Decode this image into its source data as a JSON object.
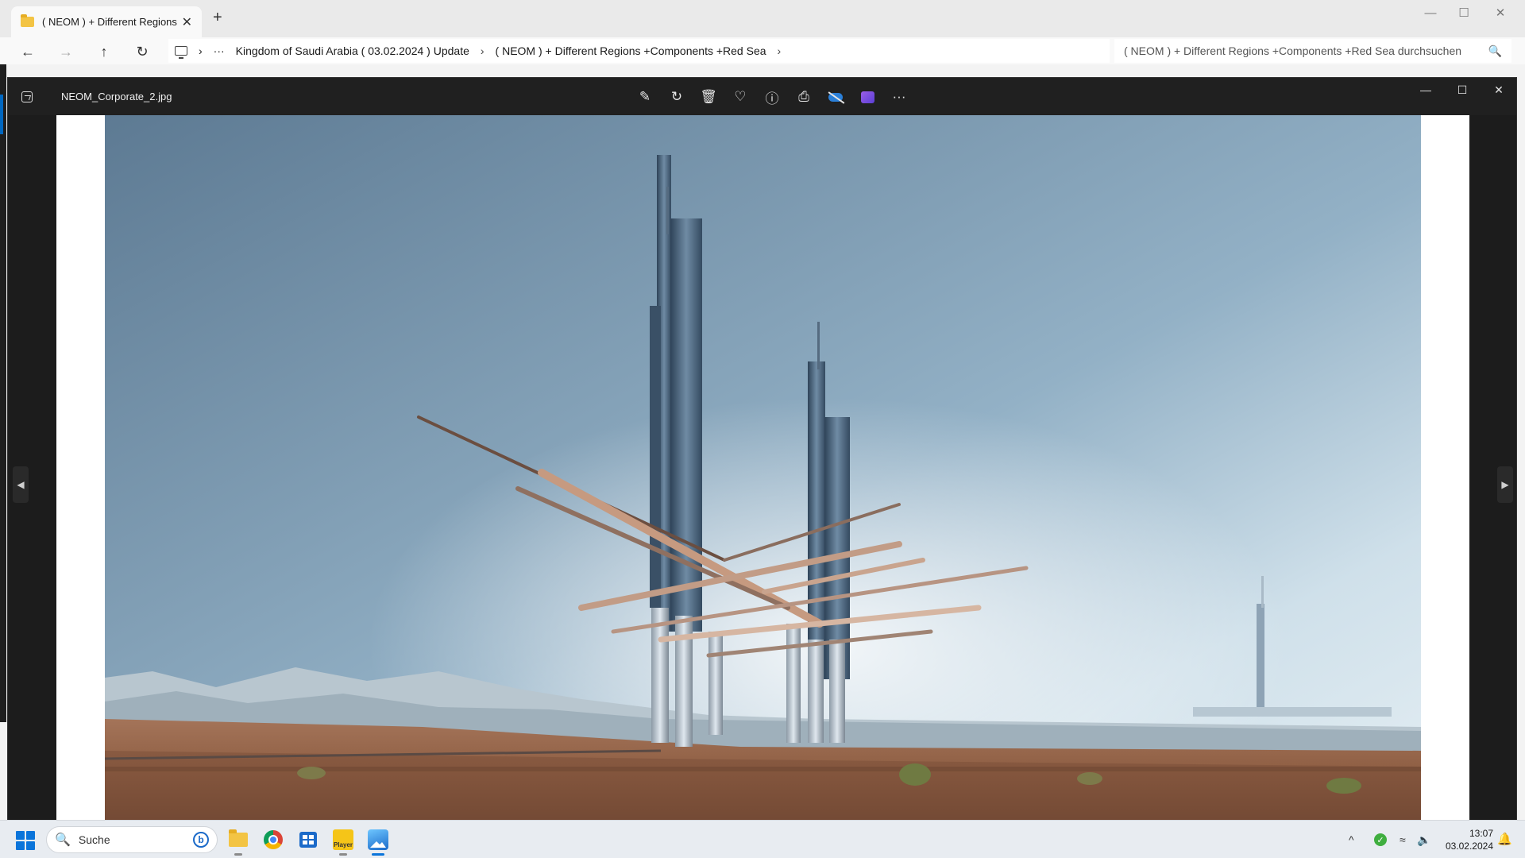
{
  "explorer": {
    "tab_title": "( NEOM ) + Different Regions",
    "new_tab": "+",
    "close_tab": "✕",
    "window_controls": {
      "minimize": "—",
      "maximize": "☐",
      "close": "✕"
    },
    "nav": {
      "back": "←",
      "forward": "→",
      "up": "↑",
      "refresh": "↻",
      "more": "···"
    },
    "breadcrumb": [
      "Kingdom of Saudi Arabia ( 03.02.2024 ) Update",
      "( NEOM ) + Different Regions +Components +Red Sea"
    ],
    "breadcrumb_sep": "›",
    "search_placeholder": "( NEOM ) + Different Regions +Components +Red Sea durchsuchen",
    "search_icon": "search-icon"
  },
  "viewer": {
    "filename": "NEOM_Corporate_2.jpg",
    "toolbar": [
      {
        "name": "edit-image",
        "glyph": "✎"
      },
      {
        "name": "rotate",
        "glyph": "↻"
      },
      {
        "name": "delete",
        "glyph": "🗑"
      },
      {
        "name": "favorite",
        "glyph": "♡"
      },
      {
        "name": "info",
        "glyph": "ⓘ"
      },
      {
        "name": "print",
        "glyph": "⎙"
      },
      {
        "name": "onedrive-off",
        "glyph": ""
      },
      {
        "name": "clipchamp",
        "glyph": ""
      },
      {
        "name": "more",
        "glyph": "···"
      }
    ],
    "window_controls": {
      "minimize": "—",
      "maximize": "☐",
      "close": "✕"
    },
    "prev": "◀",
    "next": "▶"
  },
  "taskbar": {
    "search_label": "Suche",
    "bing_glyph": "b",
    "player_label": "Player",
    "tray_chevron": "^",
    "time": "13:07",
    "date": "03.02.2024",
    "accent": "#0a74da"
  }
}
